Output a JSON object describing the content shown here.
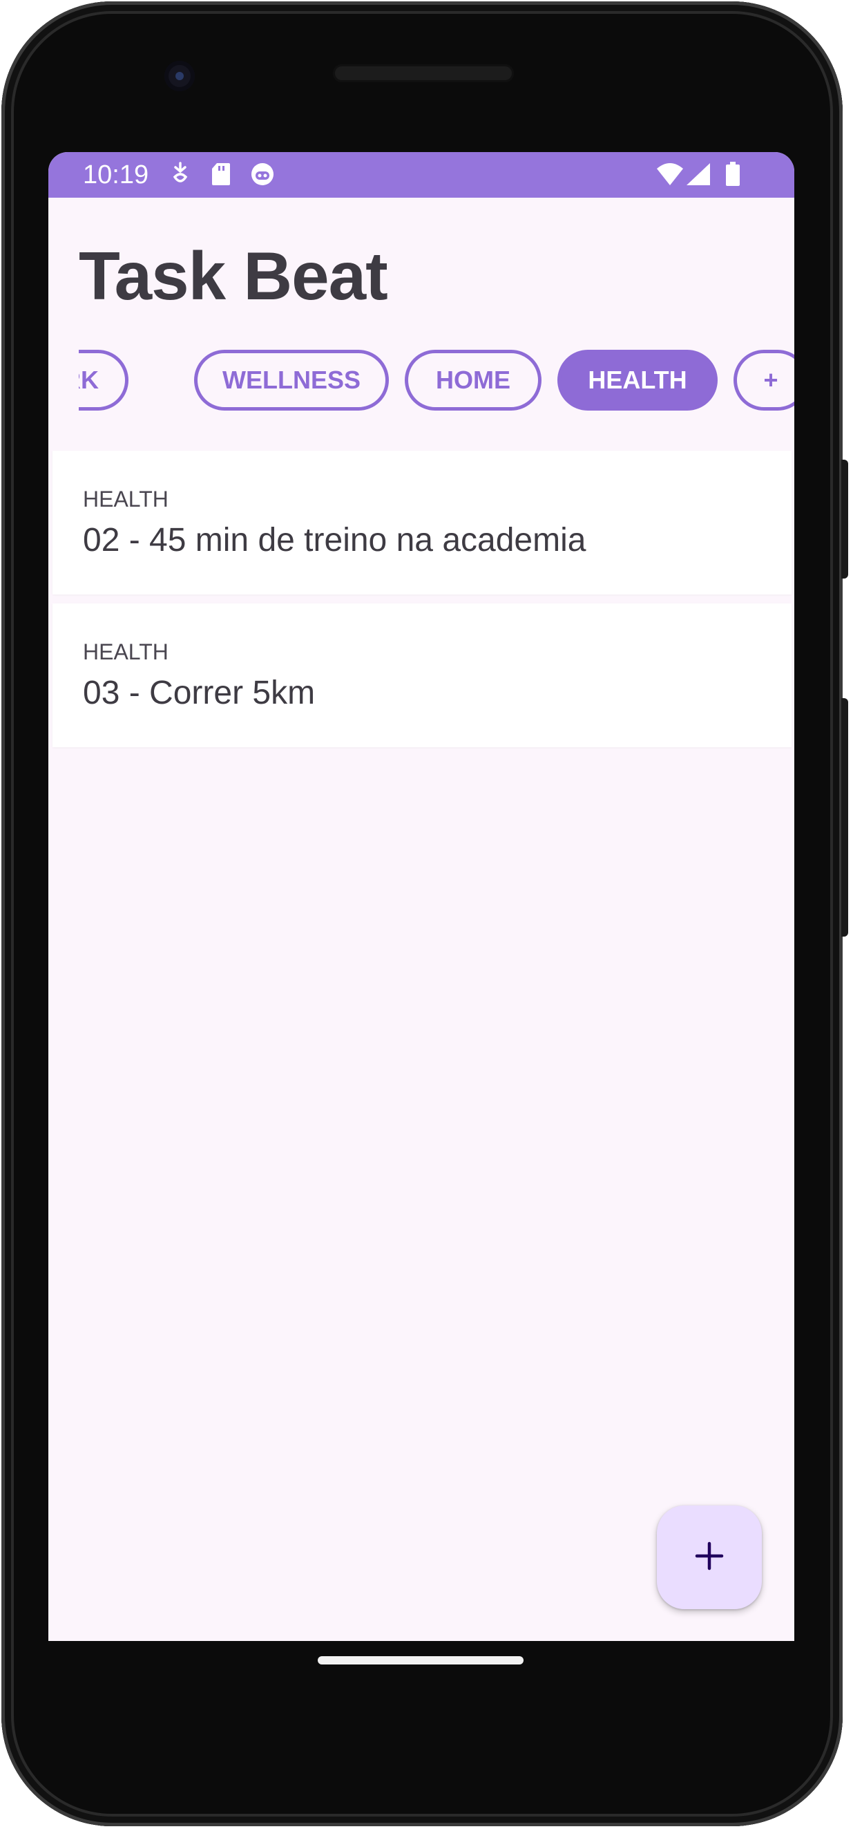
{
  "status_bar": {
    "time": "10:19",
    "icons": [
      "notification-icon",
      "sd-card-icon",
      "app-icon",
      "wifi-icon",
      "cellular-icon",
      "battery-icon"
    ]
  },
  "app": {
    "title": "Task Beat"
  },
  "categories": {
    "chips": [
      "WORK",
      "WELLNESS",
      "HOME",
      "HEALTH",
      "+"
    ],
    "visible_partial_label": "RK",
    "selected": "HEALTH"
  },
  "tasks": [
    {
      "category": "HEALTH",
      "title": "02 - 45 min de treino na academia"
    },
    {
      "category": "HEALTH",
      "title": "03 - Correr 5km"
    }
  ],
  "fab": {
    "icon": "plus-icon"
  },
  "colors": {
    "primary": "#8e6bd6",
    "status_bar": "#9575dc",
    "background": "#fcf5fc",
    "fab": "#eaddff",
    "text": "#3e3b43"
  }
}
